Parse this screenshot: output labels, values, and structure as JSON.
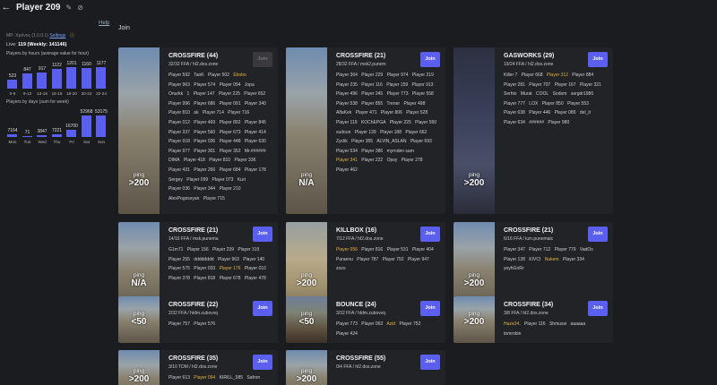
{
  "header": {
    "title": "Player 209",
    "help": "Help"
  },
  "left": {
    "mp_label": "MP:",
    "mp_value": "Χρόνος (1.0.0.1)",
    "settings": "Settings",
    "live_label": "Live:",
    "live_value": "119 (Weekly: 141146)",
    "hours_title": "Players by hours (average value for hour)",
    "days_title": "Players by days (sum for week)"
  },
  "chart_data": [
    {
      "type": "bar",
      "title": "Players by hours (average value for hour)",
      "categories": [
        "0-9",
        "9-13",
        "13-16",
        "16-18",
        "18-20",
        "20-22",
        "22-24"
      ],
      "values": [
        523,
        847,
        917,
        1122,
        1201,
        1160,
        1177
      ]
    },
    {
      "type": "bar",
      "title": "Players by days (sum for week)",
      "categories": [
        "Mon",
        "Tue",
        "Wed",
        "Thu",
        "Fri",
        "Sat",
        "Sun"
      ],
      "values": [
        7164,
        71,
        3847,
        7221,
        16700,
        52968,
        53175
      ]
    }
  ],
  "main": {
    "heading": "Join",
    "join_label": "Join",
    "ping_label": "ping"
  },
  "servers": [
    {
      "title": "CROSSFIRE (44)",
      "sub": "32/32 FFA / hl2.dos.zone",
      "ping": ">200",
      "disabled": true,
      "thumb": "",
      "players": [
        "Player 592",
        "TanK",
        "Player 502",
        "Ebobo",
        "Player 963",
        "Player 574",
        "Player 094",
        "Jopa",
        "Onurkk",
        "1",
        "Player 147",
        "Player 225",
        "Player 652",
        "Player 996",
        "Player 686",
        "Player 091",
        "Player 340",
        "Player 810",
        "ak",
        "Player 714",
        "Player 716",
        "Player 012",
        "Player 469",
        "Player 892",
        "Player 845",
        "Player 337",
        "Player 560",
        "Player 673",
        "Player 414",
        "Player 918",
        "Player 036",
        "Player 448",
        "Player 630",
        "Player 977",
        "Player 301",
        "Player 352",
        "Mr.######",
        "DIMA",
        "Player 418",
        "Player 810",
        "Player 336",
        "Player 431",
        "Player 266",
        "Player 684",
        "Player 178",
        "Sergey",
        "Player 099",
        "Player 073",
        "Kurt",
        "Player 036",
        "Player 344",
        "Player 210",
        "AlexPogossyan",
        "Player 715"
      ],
      "highlight": [
        3
      ]
    },
    {
      "title": "CROSSFIRE (21)",
      "sub": "28/32 FFA / msk2.punem",
      "ping": "N/A",
      "disabled": false,
      "thumb": "",
      "players": [
        "Player 364",
        "Player 229",
        "Player 974",
        "Player 219",
        "Player 235",
        "Player 116",
        "Player 159",
        "Player 913",
        "Player 496",
        "Player 245",
        "Player 773",
        "Player 558",
        "Player 538",
        "Player 855",
        "Trener",
        "Player 498",
        "AlfaKek",
        "Player 471",
        "Player 806",
        "Player 528",
        "Player 119",
        "KOChEPGA",
        "Player 225",
        "Player 550",
        "sudoun",
        "Player 139",
        "Player 188",
        "Player 662",
        "Zyclik",
        "Player 355",
        "ALVIN_ASLAN",
        "Player 693",
        "Player 534",
        "Player 386",
        "myrnden sam",
        "Player 341",
        "Player 222",
        "Opsy",
        "Player 278",
        "Player 462"
      ],
      "highlight": [
        35
      ]
    },
    {
      "title": "GASWORKS (29)",
      "sub": "19/24 FFA / hl2.dos.zone",
      "ping": ">200",
      "disabled": false,
      "thumb": "night",
      "players": [
        "Killer 7",
        "Player 668",
        "Player 312",
        "Player 884",
        "Player 281",
        "Player 707",
        "Player 167",
        "Player 321",
        "Serhio",
        "Murat",
        "COOL",
        "Sodom",
        "sergdr1986",
        "Player 777",
        "LOX",
        "Player 850",
        "Player 553",
        "Player 638",
        "Player 446",
        "Player 086",
        "del_it",
        "Player 634",
        "######",
        "Player 980"
      ],
      "highlight": [
        2
      ]
    },
    {
      "title": "CROSSFIRE (21)",
      "sub": "14/16 FFA / msk.punema",
      "ping": "N/A",
      "disabled": false,
      "thumb": "",
      "players": [
        "G1m71",
        "Player 156",
        "Player 239",
        "Player 319",
        "Player 255",
        "dddddddd",
        "Player 963",
        "Player 140",
        "Player 575",
        "Player 033",
        "Player 176",
        "Player 010",
        "Player 378",
        "Player 818",
        "Player 678",
        "Player 478"
      ],
      "highlight": [
        10
      ]
    },
    {
      "title": "KILLBOX (16)",
      "sub": "7/12 FFA / hl2.dos.zone",
      "ping": ">200",
      "disabled": false,
      "thumb": "sand",
      "players": [
        "Player 056",
        "Player 816",
        "Player 531",
        "Player 404",
        "Puraenu",
        "Player 787",
        "Player 792",
        "Player 947",
        "zozo"
      ],
      "highlight": [
        0
      ]
    },
    {
      "title": "CROSSFIRE (21)",
      "sub": "6/16 FFA / kzn.punematc",
      "ping": ">200",
      "disabled": false,
      "thumb": "",
      "players": [
        "Player 347",
        "Player 712",
        "Player 779",
        "VadOs",
        "Player 128",
        "KIVCI",
        "Nukem",
        "Player 334",
        "yoyhGnRr"
      ],
      "highlight": [
        6
      ]
    },
    {
      "title": "CROSSFIRE (22)",
      "sub": "2/32 FFA / hldm.zubovvq",
      "ping": "<50",
      "disabled": false,
      "thumb": "",
      "players": [
        "Player 757",
        "Player 576"
      ],
      "highlight": []
    },
    {
      "title": "BOUNCE (24)",
      "sub": "3/32 FFA / hldm.zubovvq",
      "ping": "<50",
      "disabled": false,
      "thumb": "dark",
      "players": [
        "Player 773",
        "Player 063",
        "Azid",
        "Player 752",
        "Player 424"
      ],
      "highlight": [
        2
      ]
    },
    {
      "title": "CROSSFIRE (34)",
      "sub": "3/8 FFA / hl2.dos.zone",
      "ping": ">200",
      "disabled": false,
      "thumb": "",
      "players": [
        "Haze34.",
        "Player 116",
        "Shmussi",
        "aaaaaa",
        "tomrobin"
      ],
      "highlight": [
        0
      ]
    },
    {
      "title": "CROSSFIRE (35)",
      "sub": "3/10 TDM / hl2.dos.zone",
      "ping": ">200",
      "disabled": false,
      "thumb": "",
      "players": [
        "Player 613",
        "Player 094",
        "KIRILL_585",
        "Safron"
      ],
      "highlight": [
        1
      ]
    },
    {
      "title": "CROSSFIRE (55)",
      "sub": "0/4 FFA / hl2.dos.zone",
      "ping": ">200",
      "disabled": false,
      "thumb": "",
      "players": [],
      "highlight": []
    }
  ]
}
